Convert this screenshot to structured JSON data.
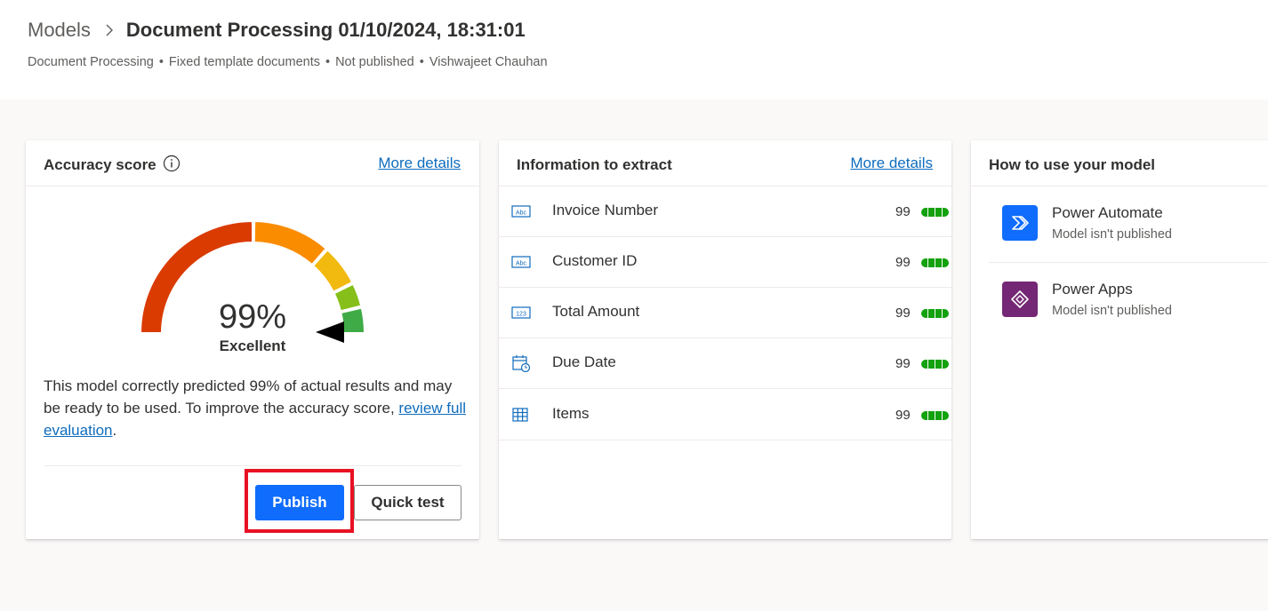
{
  "breadcrumb": {
    "parent": "Models",
    "title": "Document Processing 01/10/2024, 18:31:01"
  },
  "subline": {
    "model_type": "Document Processing",
    "template": "Fixed template documents",
    "status": "Not published",
    "owner": "Vishwajeet Chauhan"
  },
  "accuracy_card": {
    "title": "Accuracy score",
    "more_details": "More details",
    "score": "99%",
    "score_value": 0.99,
    "rating": "Excellent",
    "description": "This model correctly predicted 99% of actual results and may be ready to be used. To improve the accuracy score,",
    "review_link": "review full evaluation",
    "period": ".",
    "publish_label": "Publish",
    "quick_test_label": "Quick test",
    "gauge_colors": [
      "#da3b01",
      "#fa8c00",
      "#f2b90f",
      "#86bf1a",
      "#3fab46"
    ]
  },
  "info_card": {
    "title": "Information to extract",
    "more_details": "More details",
    "fields": [
      {
        "name": "Invoice Number",
        "icon": "text-field-icon",
        "score": "99"
      },
      {
        "name": "Customer ID",
        "icon": "text-field-icon",
        "score": "99"
      },
      {
        "name": "Total Amount",
        "icon": "number-field-icon",
        "score": "99"
      },
      {
        "name": "Due Date",
        "icon": "date-field-icon",
        "score": "99"
      },
      {
        "name": "Items",
        "icon": "table-field-icon",
        "score": "99"
      }
    ],
    "accent_color": "#13a10e",
    "icon_color": "#0f6cbd"
  },
  "usage_card": {
    "title": "How to use your model",
    "apps": [
      {
        "name": "Power Automate",
        "status": "Model isn't published",
        "icon": "power-automate-icon",
        "color": "#0f6cfd"
      },
      {
        "name": "Power Apps",
        "status": "Model isn't published",
        "icon": "power-apps-icon",
        "color": "#742774"
      }
    ]
  }
}
